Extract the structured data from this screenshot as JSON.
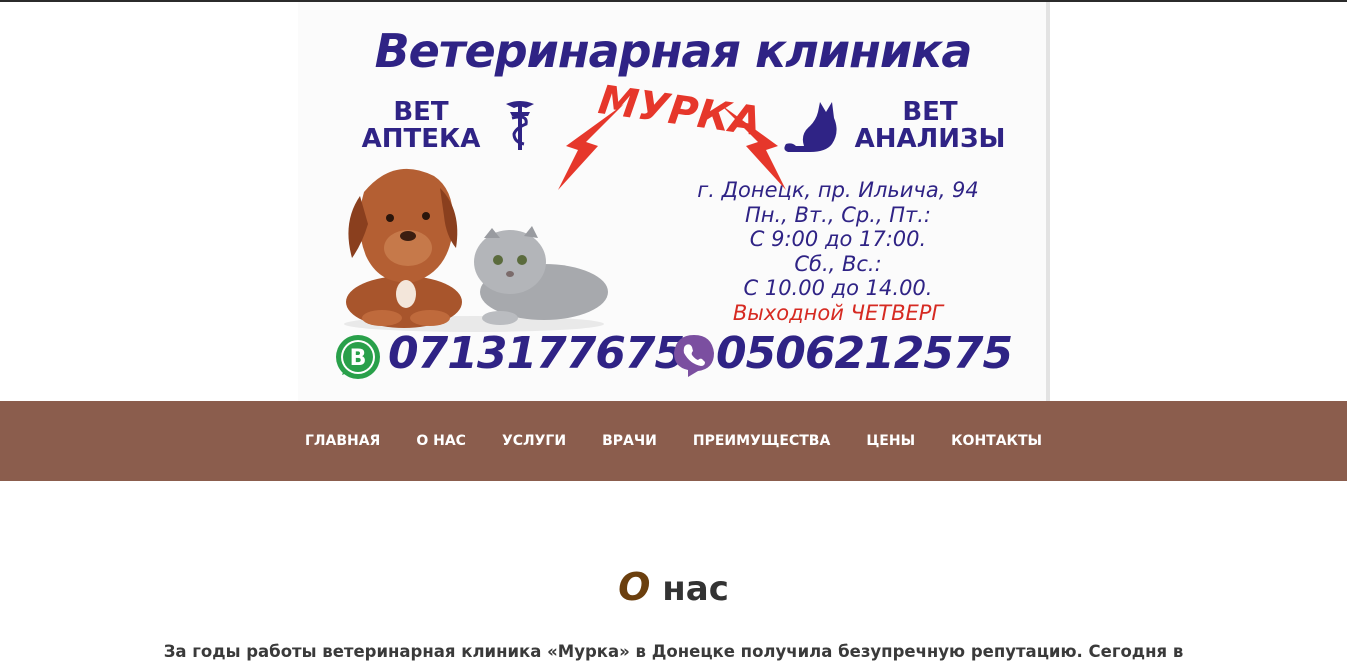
{
  "banner": {
    "title": "Ветеринарная клиника",
    "logo": "МУРКА",
    "pharmacy_line1": "ВЕТ",
    "pharmacy_line2": "АПТЕКА",
    "analysis_line1": "ВЕТ",
    "analysis_line2": "АНАЛИЗЫ",
    "info": {
      "address": "г. Донецк, пр. Ильича, 94",
      "weekdays": "Пн., Вт., Ср., Пт.:",
      "weekday_hours": "С 9:00 до 17:00.",
      "weekend": "Сб., Вс.:",
      "weekend_hours": "С 10.00 до 14.00.",
      "closed": "Выходной ЧЕТВЕРГ"
    },
    "phone1": "0713177675",
    "phone2": "0506212575",
    "icons": {
      "messenger_b": "whatsapp-b-icon",
      "viber": "viber-icon",
      "caduceus": "caduceus-icon",
      "cat": "cat-silhouette-icon"
    },
    "colors": {
      "primary": "#2f2385",
      "accent": "#e6372b"
    }
  },
  "nav": {
    "items": [
      "ГЛАВНАЯ",
      "О НАС",
      "УСЛУГИ",
      "ВРАЧИ",
      "ПРЕИМУЩЕСТВА",
      "ЦЕНЫ",
      "КОНТАКТЫ"
    ],
    "background": "#8b5d4d"
  },
  "about": {
    "title_first": "О",
    "title_rest": " нас",
    "intro": "За годы работы ветеринарная клиника «Мурка» в Донецке получила безупречную репутацию. Сегодня в"
  }
}
